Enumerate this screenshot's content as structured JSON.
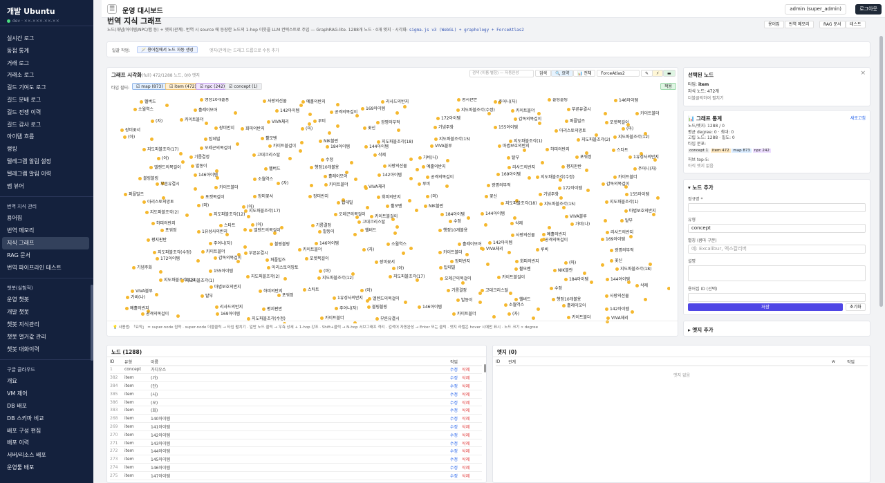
{
  "sidebar": {
    "title": "개발 Ubuntu",
    "env": "dev · ××.×××.××.××",
    "items": [
      "실시간 로그",
      "동접 통계",
      "거래 로그",
      "거래소 로그",
      "길드 기여도 로그",
      "길드 분배 로그",
      "길드 전쟁 이력",
      "길드 감사 로그",
      "아이템 흐름",
      "랭킹",
      "텔레그램 알림 설정",
      "텔레그램 알림 이력",
      "맵 뷰어"
    ],
    "section2": "번역 지식 관리",
    "items2": [
      "용어집",
      "번역 메모리",
      "지식 그래프",
      "RAG 문서",
      "번역 파이프라인 테스트"
    ],
    "section3": "챗봇(실험적)",
    "items3": [
      "운영 챗봇",
      "개발 챗봇",
      "챗봇 지식관리",
      "챗봇 열거값 관리",
      "챗봇 대화이력"
    ],
    "section4": "구글 클라우드",
    "items4": [
      "개요",
      "VM 제어",
      "DB 배포",
      "DB 스키마 비교",
      "배포 구성 편집",
      "배포 이력",
      "서버/리소스 배포",
      "운영툴 배포"
    ]
  },
  "topbar": {
    "title": "운영 대시보드",
    "user": "admin (super_admin)",
    "logout": "로그아웃",
    "menu_icon": "hamburger-icon"
  },
  "page": {
    "title": "번역 지식 그래프",
    "desc": "노드(개념/아이템/NPC/맵 등) + 엣지(관계). 번역 시 source 에 등장한 노드의 1-hop 이웃을 LLM 컨텍스트로 주입 — GraphRAG-lite. 1288개 노드 · 0개 엣지 · 시각화: ",
    "desc_tech": "sigma.js v3 (WebGL) + graphology + ForceAtlas2",
    "buttons": [
      "용어집",
      "번역 메모리",
      "RAG 문서",
      "테스트"
    ]
  },
  "batch": {
    "label": "일괄 작업:",
    "button": "🪄 용어집에서 노드 자동 생성",
    "hint": "엣지(관계)는 드래그 드롭으로 수동 추가"
  },
  "graph": {
    "title": "그래프 시각화",
    "count": "(full) 472/1288 노드, 0/0 엣지",
    "search_placeholder": "검색 (이름·별칭) — 자동완성",
    "search_btn": "검색",
    "summary_btn": "🔍 요약",
    "full_btn": "📊 전체",
    "layout": "ForceAtlas2",
    "filter_label": "타입 필터:",
    "filters": [
      "map (873)",
      "item (472)",
      "npc (242)",
      "concept (1)"
    ],
    "apply": "적용",
    "footer": "💡 사용법: 「요약」 = super-node 집약 · super-node 더블클릭 → 타입 펼치기 · 일반 노드 클릭 → 우측 상세 + 1-hop 강조 · Shift+클릭 → N-hop 서브그래프 격리 · 검색어 자동완성 → Enter 또는 클릭 · 엣지 라벨은 hover 시에만 표시 · 노드 크기 ∝ degree",
    "nodes": [
      "헬버드",
      "행정10개볼용",
      "사랑의선물",
      "예홀의반지",
      "리사드의반지",
      "평지판반",
      "주어니(자)",
      "블링블링",
      "146아이템",
      "소월역스",
      "흘레이모어",
      "142아이템",
      "공격의목걸이",
      "169아이템",
      "지도파블조각(수정)",
      "카이트블더",
      "부른유결시",
      "카이트블더",
      "(자)",
      "카이트블더",
      "VIVA체리",
      "루비",
      "광명의부적",
      "172아이템",
      "감독의목걸이",
      "퍼플빌즈",
      "포켓목걸이",
      "장미꽃서",
      "장미반지",
      "회피의반지",
      "(마)",
      "꽃신",
      "기념주화",
      "155아이템",
      "아리스토의망토",
      "(마)",
      "(아)",
      "탑데빌",
      "휠모벤",
      "NIK블란",
      "지도파블조각(18)",
      "지도파블조각(15)",
      "지도파블조각(1)",
      "지도파블조각(2)",
      "지도파블조각(12)",
      "지도파블조각(17)",
      "오레곤의목걸이",
      "카이트블걸이",
      "184아이템",
      "144아이템",
      "VIVA블루",
      "마법보호의반지",
      "하피의반지",
      "스타트",
      "(아)",
      "기름결정",
      "고대크리스탈"
    ],
    "extra_nodes": [
      "수정",
      "삭제",
      "가비(나)",
      "탈부",
      "포워정",
      "1유성사의반지",
      "엘렌드의목걸이",
      "발동이"
    ]
  },
  "selected": {
    "title": "선택된 노드",
    "type_label": "타입: ",
    "type": "item",
    "sub_label": "자식 노드: ",
    "sub": "472개",
    "hint": "더블클릭하여 펼치기"
  },
  "stats": {
    "title": "📊 그래프 통계",
    "refresh": "새로고침",
    "lines": [
      "노드/엣지: 1288 / 0",
      "평균 degree: 0 · 최대: 0",
      "고립 노드: 1288 · 밀도: 0",
      "타입 분포:"
    ],
    "badges": [
      "concept 1",
      "item 472",
      "map 873",
      "npc 242"
    ],
    "hub": "허브 top-5:",
    "hub_val": "아직 엣지 없음"
  },
  "add_node": {
    "title": "▾ 노드 추가",
    "f1": "정규명 *",
    "f2": "유형",
    "f2_val": "concept",
    "f3": "별칭 (콤마 구분)",
    "f3_ph": "예: Excalibur, 엑스칼리버",
    "f4": "설명",
    "f5": "용어집 ID (선택)",
    "save": "저장",
    "reset": "초기화"
  },
  "add_edge": {
    "title": "▸ 엣지 추가"
  },
  "nodes_table": {
    "title": "노드 (1288)",
    "cols": [
      "ID",
      "유형",
      "이름",
      "작업"
    ],
    "edit": "수정",
    "del": "삭제",
    "rows": [
      [
        "1",
        "concept",
        "가디우스"
      ],
      [
        "382",
        "item",
        "(가)"
      ],
      [
        "384",
        "item",
        "(단)"
      ],
      [
        "385",
        "item",
        "(사)"
      ],
      [
        "386",
        "item",
        "(오)"
      ],
      [
        "383",
        "item",
        "(화)"
      ],
      [
        "268",
        "item",
        "140아이템"
      ],
      [
        "269",
        "item",
        "141아이템"
      ],
      [
        "270",
        "item",
        "142아이템"
      ],
      [
        "271",
        "item",
        "143아이템"
      ],
      [
        "272",
        "item",
        "144아이템"
      ],
      [
        "273",
        "item",
        "145아이템"
      ],
      [
        "274",
        "item",
        "146아이템"
      ],
      [
        "275",
        "item",
        "147아이템"
      ]
    ]
  },
  "edges_table": {
    "title": "엣지 (0)",
    "cols": [
      "ID",
      "관계",
      "w",
      "작업"
    ],
    "empty": "엣지 없음"
  }
}
